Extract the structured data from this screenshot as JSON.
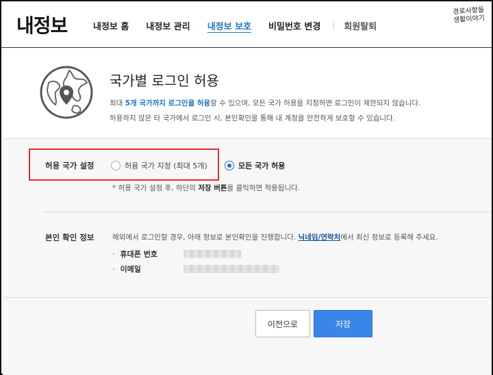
{
  "header": {
    "brand": "내정보",
    "nav": [
      {
        "label": "내정보 홈",
        "active": false
      },
      {
        "label": "내정보 관리",
        "active": false
      },
      {
        "label": "내정보 보호",
        "active": true
      },
      {
        "label": "비밀번호 변경",
        "active": false
      },
      {
        "label": "회원탈퇴",
        "active": false
      }
    ],
    "watermark_line1": "경로사항들",
    "watermark_line2": "생활이야기"
  },
  "intro": {
    "title": "국가별 로그인 허용",
    "desc1_pre": "최대 ",
    "desc1_hl": "5개 국가까지 로그인을 허용",
    "desc1_post": "할 수 있으며, 모든 국가 허용을 지정하면 로그인이 제한되지 않습니다.",
    "desc2": "허용하지 않은 타 국가에서 로그인 시, 본인확인을 통해 내 계정을 안전하게 보호할 수 있습니다."
  },
  "settings": {
    "label": "허용 국가 설정",
    "option_specific": "허용 국가 지정 (최대 5개)",
    "option_all": "모든 국가 허용",
    "selected": "all",
    "note_pre": "* 허용 국가 설정 후, 하단의 ",
    "note_bold": "저장 버튼",
    "note_post": "을 클릭하면 적용됩니다."
  },
  "verify": {
    "label": "본인 확인 정보",
    "desc_pre": "해외에서 로그인할 경우, 아래 정보로 본인확인을 진행합니다. ",
    "desc_link": "닉네임/연락처",
    "desc_post": "에서 최신 정보로 등록해 주세요.",
    "dot": "·",
    "phone_label": "휴대폰 번호",
    "email_label": "이메일"
  },
  "buttons": {
    "prev": "이전으로",
    "save": "저장"
  },
  "colors": {
    "accent": "#1a73c7",
    "save_bg": "#3a86e8",
    "highlight_box": "#e32b2b"
  }
}
